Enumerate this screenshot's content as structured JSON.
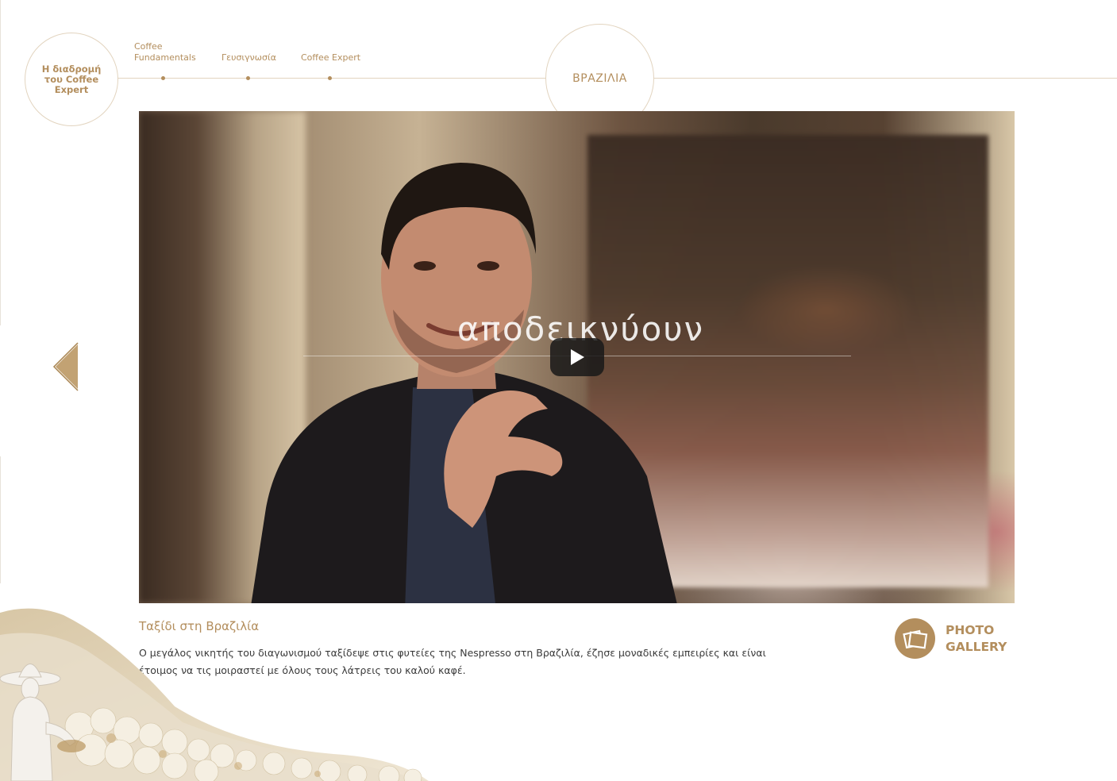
{
  "nav": {
    "home_label": "Η διαδρομή του Coffee Expert",
    "items": [
      {
        "label": "Coffee\nFundamentals"
      },
      {
        "label": "Γευσιγνωσία"
      },
      {
        "label": "Coffee Expert"
      }
    ],
    "active_label": "ΒΡΑΖΙΛΙΑ"
  },
  "video": {
    "caption_word": "αποδεικνύουν"
  },
  "content": {
    "title": "Ταξίδι στη Βραζιλία",
    "description": "Ο μεγάλος νικητής του διαγωνισμού ταξίδεψε στις φυτείες της Nespresso στη Βραζιλία, έζησε μοναδικές εμπειρίες και είναι έτοιμος να τις μοιραστεί με όλους τους λάτρεις του καλού καφέ."
  },
  "gallery": {
    "line1": "PHOTO",
    "line2": "GALLERY"
  },
  "colors": {
    "accent": "#b38e5d",
    "line": "#e2d4bf"
  },
  "icons": {
    "prev": "prev-arrow-icon",
    "play": "play-icon",
    "gallery": "photos-icon"
  }
}
